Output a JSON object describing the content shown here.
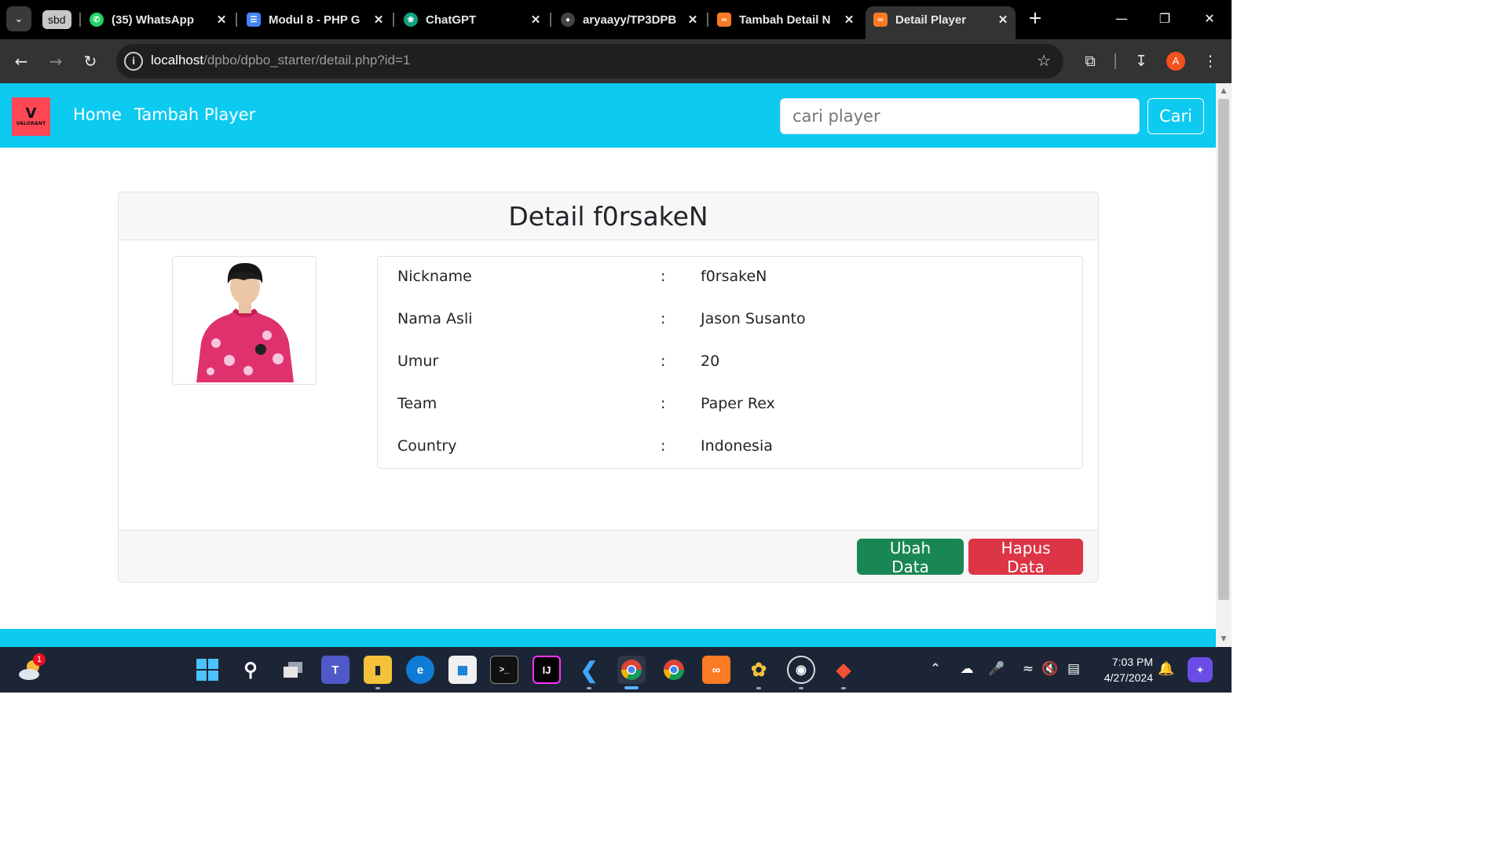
{
  "browser": {
    "tab_group_label": "sbd",
    "tabs": [
      {
        "title": "(35) WhatsApp",
        "badge": "35"
      },
      {
        "title": "Modul 8 - PHP G"
      },
      {
        "title": "ChatGPT"
      },
      {
        "title": "aryaayy/TP3DPB"
      },
      {
        "title": "Tambah Detail N"
      },
      {
        "title": "Detail Player"
      }
    ],
    "url_host": "localhost",
    "url_path": "/dpbo/dpbo_starter/detail.php?id=1",
    "profile_initial": "A"
  },
  "site": {
    "logo_text": "VALORANT",
    "nav": {
      "home": "Home",
      "add_player": "Tambah Player"
    },
    "search": {
      "placeholder": "cari player",
      "button": "Cari"
    }
  },
  "detail": {
    "title": "Detail f0rsakeN",
    "rows": [
      {
        "label": "Nickname",
        "colon": ":",
        "value": "f0rsakeN"
      },
      {
        "label": "Nama Asli",
        "colon": ":",
        "value": "Jason Susanto"
      },
      {
        "label": "Umur",
        "colon": ":",
        "value": "20"
      },
      {
        "label": "Team",
        "colon": ":",
        "value": "Paper Rex"
      },
      {
        "label": "Country",
        "colon": ":",
        "value": "Indonesia"
      }
    ],
    "buttons": {
      "edit": "Ubah Data",
      "delete": "Hapus Data"
    }
  },
  "taskbar": {
    "weather_badge": "1",
    "time": "7:03 PM",
    "date": "4/27/2024"
  },
  "colors": {
    "navbar": "#0dcaf0",
    "logo_bg": "#ff4655",
    "edit_button": "#198754",
    "delete_button": "#dc3545"
  }
}
